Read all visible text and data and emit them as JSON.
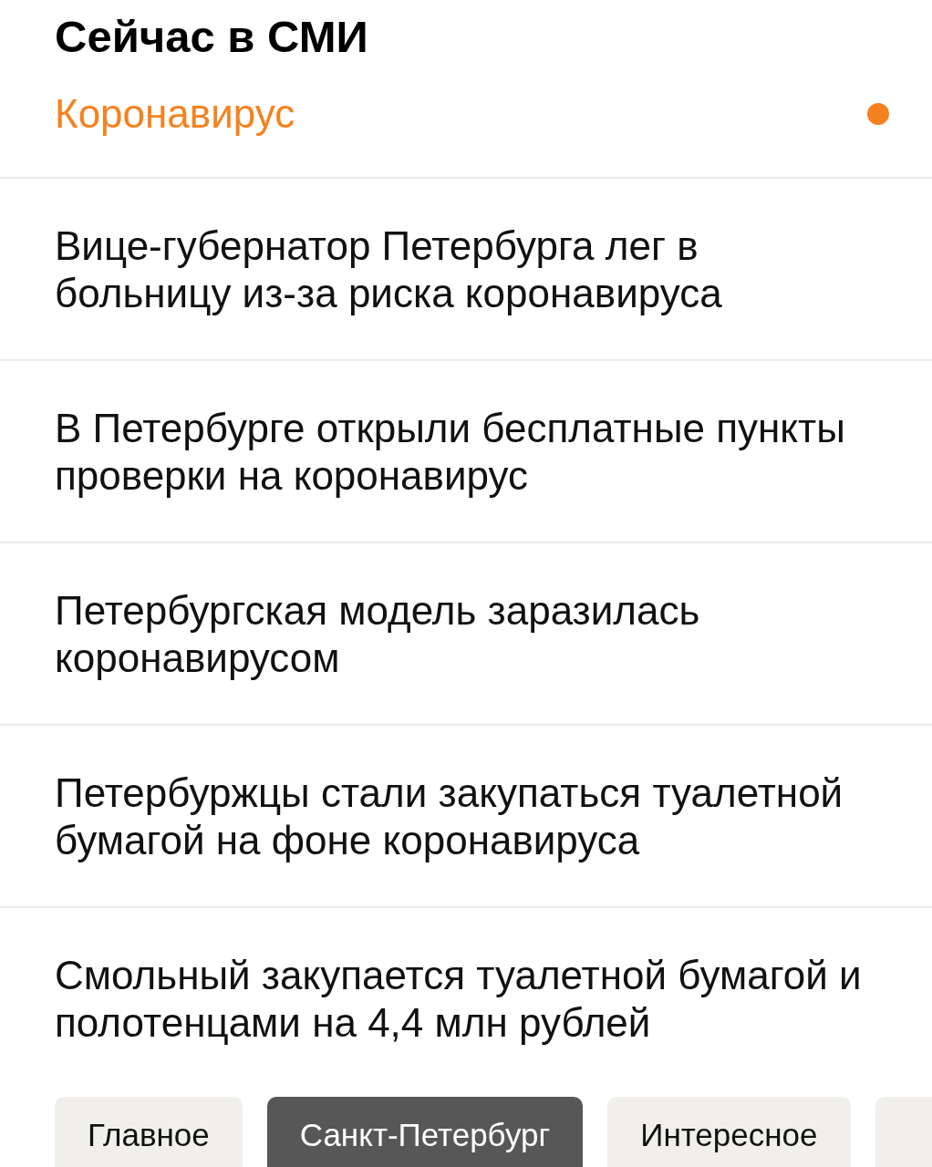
{
  "header": {
    "title": "Сейчас в СМИ"
  },
  "topic": {
    "label": "Коронавирус"
  },
  "news": [
    {
      "headline": "Вице-губернатор Петербурга лег в больницу из-за риска коронавируса"
    },
    {
      "headline": "В Петербурге открыли бесплатные пункты проверки на коронавирус"
    },
    {
      "headline": "Петербургская модель заразилась коронавирусом"
    },
    {
      "headline": "Петербуржцы стали закупаться туалетной бумагой на фоне коронавируса"
    },
    {
      "headline": "Смольный закупается туалетной бумагой и полотенцами на 4,4 млн рублей"
    }
  ],
  "tabs": [
    {
      "label": "Главное",
      "selected": false
    },
    {
      "label": "Санкт-Петербург",
      "selected": true
    },
    {
      "label": "Интересное",
      "selected": false
    },
    {
      "selected": false
    }
  ]
}
